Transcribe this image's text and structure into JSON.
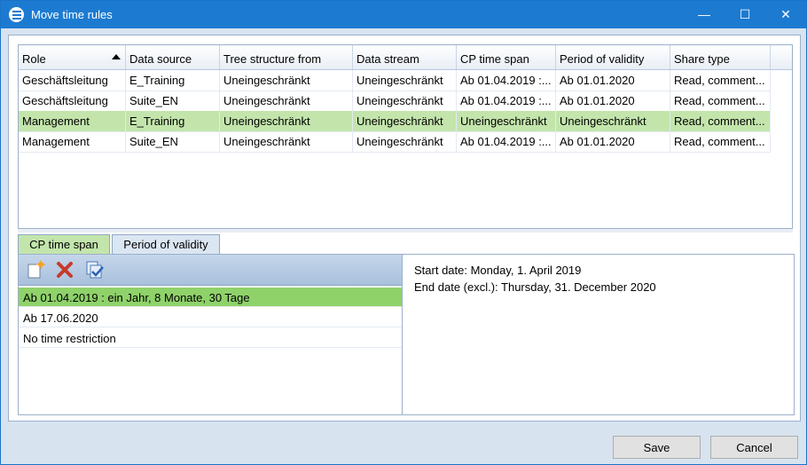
{
  "window": {
    "title": "Move time rules",
    "accent": "#1c7bd1"
  },
  "title_controls": {
    "minimize_glyph": "—",
    "maximize_glyph": "☐",
    "close_glyph": "✕"
  },
  "grid": {
    "columns": [
      "Role",
      "Data source",
      "Tree structure from",
      "Data stream",
      "CP time span",
      "Period of validity",
      "Share type"
    ],
    "sort_column": "Role",
    "rows": [
      [
        "Geschäftsleitung",
        "E_Training",
        "Uneingeschränkt",
        "Uneingeschränkt",
        "Ab 01.04.2019 :...",
        "Ab 01.01.2020",
        "Read, comment..."
      ],
      [
        "Geschäftsleitung",
        "Suite_EN",
        "Uneingeschränkt",
        "Uneingeschränkt",
        "Ab 01.04.2019 :...",
        "Ab 01.01.2020",
        "Read, comment..."
      ],
      [
        "Management",
        "E_Training",
        "Uneingeschränkt",
        "Uneingeschränkt",
        "Uneingeschränkt",
        "Uneingeschränkt",
        "Read, comment..."
      ],
      [
        "Management",
        "Suite_EN",
        "Uneingeschränkt",
        "Uneingeschränkt",
        "Ab 01.04.2019 :...",
        "Ab 01.01.2020",
        "Read, comment..."
      ]
    ],
    "selected_row": 2,
    "selection_color": "#c3e5ac"
  },
  "tabs": [
    {
      "label": "CP time span",
      "active": true
    },
    {
      "label": "Period of validity",
      "active": false
    }
  ],
  "toolbar": {
    "icons": [
      "new-item-icon",
      "delete-icon",
      "apply-icon"
    ]
  },
  "time_spans": {
    "items": [
      "Ab 01.04.2019 : ein Jahr, 8 Monate, 30 Tage",
      "Ab 17.06.2020",
      "No time restriction"
    ],
    "selected": 0,
    "selection_color": "#8fd26a"
  },
  "details": {
    "start": "Start date: Monday, 1. April 2019",
    "end": "End date (excl.): Thursday, 31. December 2020"
  },
  "footer": {
    "save_label": "Save",
    "cancel_label": "Cancel"
  }
}
